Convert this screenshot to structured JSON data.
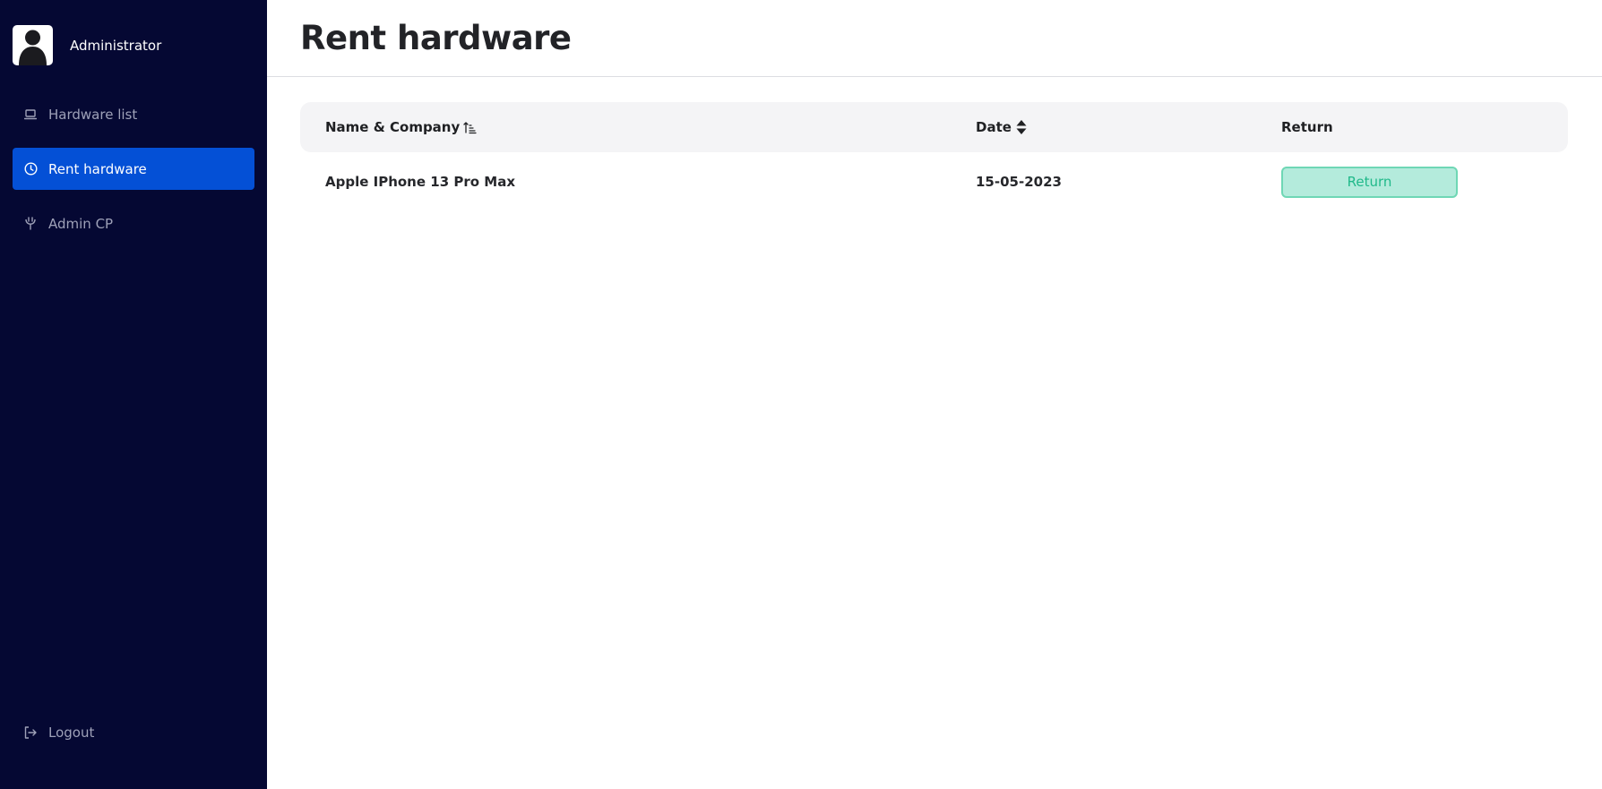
{
  "sidebar": {
    "user_name": "Administrator",
    "items": [
      {
        "label": "Hardware list",
        "icon": "laptop-icon",
        "active": false
      },
      {
        "label": "Rent hardware",
        "icon": "clock-icon",
        "active": true
      },
      {
        "label": "Admin CP",
        "icon": "plug-icon",
        "active": false
      }
    ],
    "logout_label": "Logout"
  },
  "header": {
    "title": "Rent hardware"
  },
  "table": {
    "columns": {
      "name": "Name & Company",
      "date": "Date",
      "return": "Return"
    },
    "rows": [
      {
        "name": "Apple IPhone 13 Pro Max",
        "date": "15-05-2023",
        "action_label": "Return"
      }
    ]
  },
  "colors": {
    "sidebar_bg": "#050833",
    "active_item": "#0450d6",
    "return_button_bg": "#b4ebdc",
    "return_button_text": "#20b98a"
  }
}
